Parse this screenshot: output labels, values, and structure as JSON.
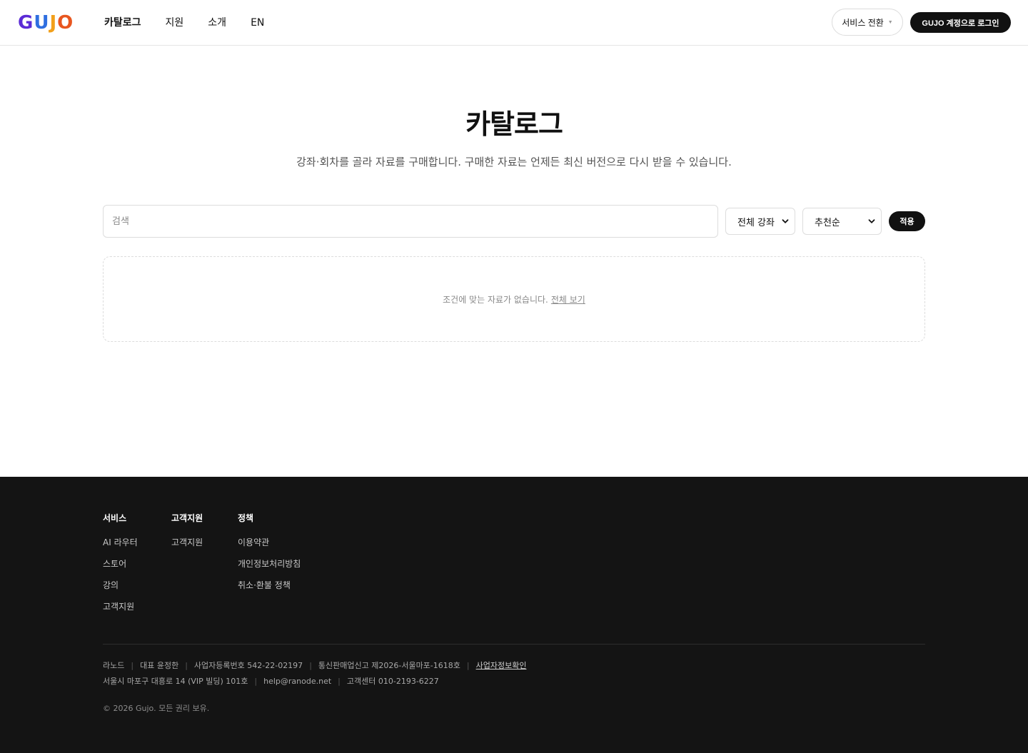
{
  "header": {
    "logo_letters": [
      {
        "char": "G",
        "color": "#5b2bd6"
      },
      {
        "char": "U",
        "color": "#2f6fe0"
      },
      {
        "char": "J",
        "color": "#f2a01b"
      },
      {
        "char": "O",
        "color": "#e8561f"
      }
    ],
    "nav": [
      {
        "label": "카탈로그",
        "active": true
      },
      {
        "label": "지원",
        "active": false
      },
      {
        "label": "소개",
        "active": false
      },
      {
        "label": "EN",
        "active": false
      }
    ],
    "service_switch_label": "서비스 전환",
    "login_label": "GUJO 계정으로 로그인"
  },
  "main": {
    "title": "카탈로그",
    "subtitle": "강좌·회차를 골라 자료를 구매합니다. 구매한 자료는 언제든 최신 버전으로 다시 받을 수 있습니다.",
    "search_placeholder": "검색",
    "course_filter_value": "전체 강좌",
    "sort_value": "추천순",
    "apply_label": "적용",
    "empty_message": "조건에 맞는 자료가 없습니다.",
    "empty_link": "전체 보기"
  },
  "footer": {
    "columns": [
      {
        "heading": "서비스",
        "links": [
          "AI 라우터",
          "스토어",
          "강의",
          "고객지원"
        ]
      },
      {
        "heading": "고객지원",
        "links": [
          "고객지원"
        ]
      },
      {
        "heading": "정책",
        "links": [
          "이용약관",
          "개인정보처리방침",
          "취소·환불 정책"
        ]
      }
    ],
    "business_line1": [
      "라노드",
      "대표 윤정한",
      "사업자등록번호 542-22-02197",
      "통신판매업신고 제2026-서울마포-1618호"
    ],
    "business_link": "사업자정보확인",
    "business_line2": [
      "서울시 마포구 대흥로 14 (VIP 빌딩) 101호",
      "help@ranode.net",
      "고객센터 010-2193-6227"
    ],
    "copyright": "© 2026 Gujo. 모든 권리 보유."
  },
  "colors": {
    "accent": "#111111",
    "footer_bg": "#141414"
  }
}
